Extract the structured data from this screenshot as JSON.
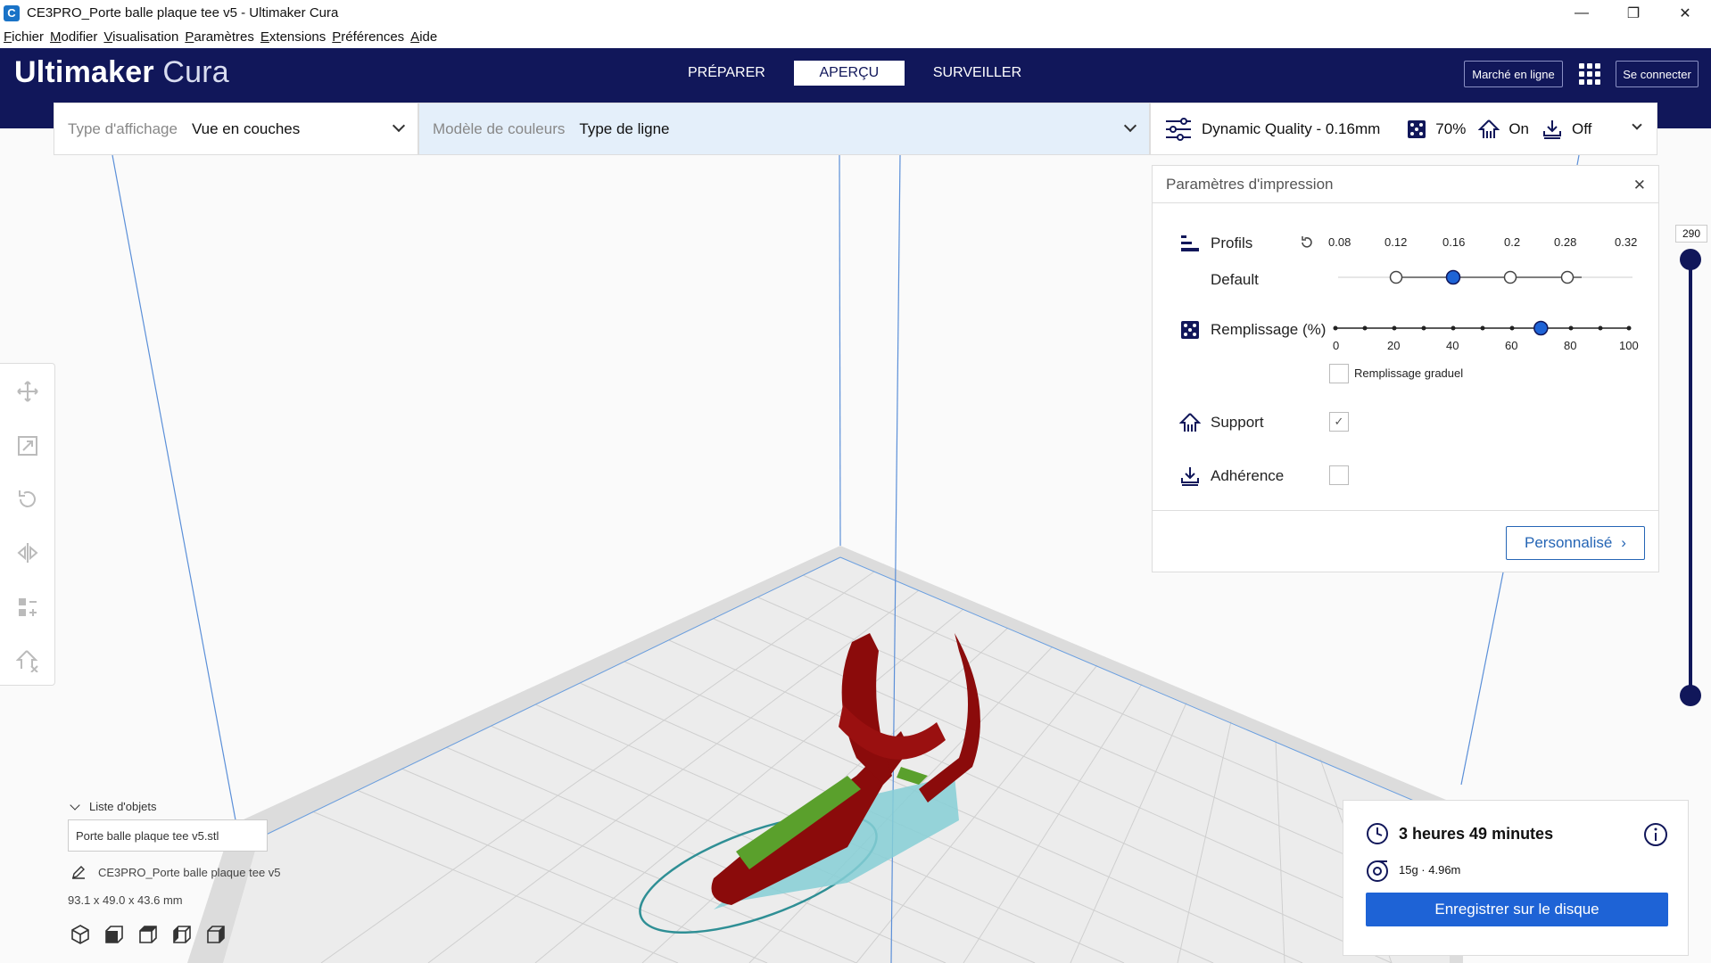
{
  "window": {
    "title": "CE3PRO_Porte balle plaque tee v5 - Ultimaker Cura",
    "minimize_glyph": "—",
    "restore_glyph": "❐",
    "close_glyph": "✕"
  },
  "menu": {
    "items": [
      {
        "label": "Fichier"
      },
      {
        "label": "Modifier"
      },
      {
        "label": "Visualisation"
      },
      {
        "label": "Paramètres"
      },
      {
        "label": "Extensions"
      },
      {
        "label": "Préférences"
      },
      {
        "label": "Aide"
      }
    ]
  },
  "header": {
    "logo_bold": "Ultimaker",
    "logo_light": "Cura",
    "tabs": [
      {
        "label": "PRÉPARER",
        "active": false
      },
      {
        "label": "APERÇU",
        "active": true
      },
      {
        "label": "SURVEILLER",
        "active": false
      }
    ],
    "marketplace_label": "Marché en ligne",
    "signin_label": "Se connecter"
  },
  "toolbar": {
    "view_type_label": "Type d'affichage",
    "view_type_value": "Vue en couches",
    "color_model_label": "Modèle de couleurs",
    "color_model_value": "Type de ligne",
    "profile_summary": "Dynamic Quality - 0.16mm",
    "infill_summary": "70%",
    "support_summary": "On",
    "adhesion_summary": "Off"
  },
  "print_settings": {
    "title": "Paramètres d'impression",
    "close_glyph": "✕",
    "profiles_label": "Profils",
    "profile_name": "Default",
    "layer_heights": [
      "0.08",
      "0.12",
      "0.16",
      "0.2",
      "0.28",
      "0.32"
    ],
    "selected_layer_height": "0.16",
    "infill_label": "Remplissage (%)",
    "infill_ticks": [
      "0",
      "20",
      "40",
      "60",
      "80",
      "100"
    ],
    "infill_value": 70,
    "gradual_infill_label": "Remplissage graduel",
    "gradual_infill_checked": false,
    "support_label": "Support",
    "support_checked": true,
    "adhesion_label": "Adhérence",
    "adhesion_checked": false,
    "custom_label": "Personnalisé"
  },
  "layer_slider": {
    "top_value": "290"
  },
  "object_list": {
    "title": "Liste d'objets",
    "file_name": "Porte balle plaque tee v5.stl",
    "job_name": "CE3PRO_Porte balle plaque tee v5",
    "dimensions": "93.1 x 49.0 x 43.6 mm"
  },
  "print_info": {
    "time": "3 heures 49 minutes",
    "material": "15g · 4.96m",
    "save_label": "Enregistrer sur le disque"
  },
  "colors": {
    "header": "#11175a",
    "accent": "#1e63d6",
    "model_wall": "#8b0b0b",
    "model_support": "#86cfd6",
    "model_infill": "#5aa02c"
  }
}
